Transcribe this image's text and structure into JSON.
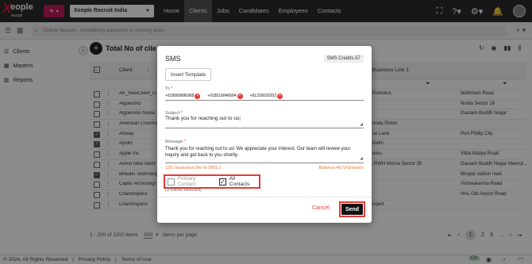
{
  "topbar": {
    "logo_main": "eople",
    "logo_sub": "recruit",
    "org": "Xeople Recruit India",
    "nav": [
      "Home",
      "Clients",
      "Jobs",
      "Candidates",
      "Employees",
      "Contacts"
    ],
    "active_nav": "Clients"
  },
  "search": {
    "placeholder": "Global Search - Something awesome is coming soon"
  },
  "sidebar": {
    "items": [
      "Clients",
      "Masters",
      "Reports"
    ]
  },
  "page": {
    "title": "Total No of clie"
  },
  "table": {
    "headers": [
      "Client",
      "Business Line 1"
    ],
    "rows": [
      {
        "name": "AK_NewClient_G",
        "addr": "Romulus",
        "city": "Wahrman Road",
        "checked": false
      },
      {
        "name": "Algoworks",
        "addr": "",
        "city": "Noida Sector 18",
        "checked": false
      },
      {
        "name": "Algoworks Noida",
        "addr": "",
        "city": "Gautam Buddh Nagar",
        "checked": false
      },
      {
        "name": "American Country",
        "addr": "unda Street",
        "city": "",
        "checked": false
      },
      {
        "name": "Artway",
        "addr": "se Lane",
        "city": "Port Phillip City",
        "checked": true
      },
      {
        "name": "Apollo",
        "addr": "Delhi",
        "city": "",
        "checked": true
      },
      {
        "name": "Apple Inc.",
        "addr": "umu",
        "city": "Vittal Mallya Road",
        "checked": false
      },
      {
        "name": "Avtivo New client",
        "addr": "-RWH Morna Sector 35",
        "city": "Gautam Buddh Nagar Meerut...",
        "checked": false
      },
      {
        "name": "Bhaulei Technolog",
        "addr": "",
        "city": "Bhopal station road",
        "checked": true
      },
      {
        "name": "Capla Technologi",
        "addr": "",
        "city": "Vishwakarma Road",
        "checked": false
      },
      {
        "name": "Chandrayan1",
        "addr": "",
        "city": "HAL Old Airport Road",
        "checked": false
      },
      {
        "name": "Chandrayan2",
        "addr": "roject",
        "city": "",
        "checked": false
      }
    ]
  },
  "footer": {
    "range": "1 - 200 of 1102 items",
    "page_size": "200",
    "page_size_label": "items per page",
    "pages": [
      "1",
      "2",
      "3"
    ]
  },
  "bottom": {
    "copyright": "© 2024, All Rights Reserved",
    "privacy": "Privacy Policy",
    "terms": "Terms of Use",
    "lang": "EN"
  },
  "modal": {
    "title": "SMS",
    "credits": "SMS Credits-57",
    "insert_template": "Insert Template",
    "to_label": "To",
    "recipients": [
      "+918968686968",
      "+918516846684",
      "+91220020202"
    ],
    "subject_label": "Subject",
    "subject_value": "Thank you for reaching out to us",
    "message_label": "Message",
    "message_value": "Thank you for reaching out to us! We appreciate your interest. Our team will review your inquiry and get back to you shortly.",
    "char_info": "125 characters |No of SMS:1",
    "balance_info": "Balance:467characters",
    "primary_contact": "Primary Contact",
    "all_contacts": "All Contacts",
    "selected_info": "(3 clients selected)",
    "cancel": "Cancel",
    "send": "Send"
  },
  "colors": {
    "accent": "#c2185b",
    "highlight": "#e53935",
    "dark": "#2b2b2b"
  }
}
